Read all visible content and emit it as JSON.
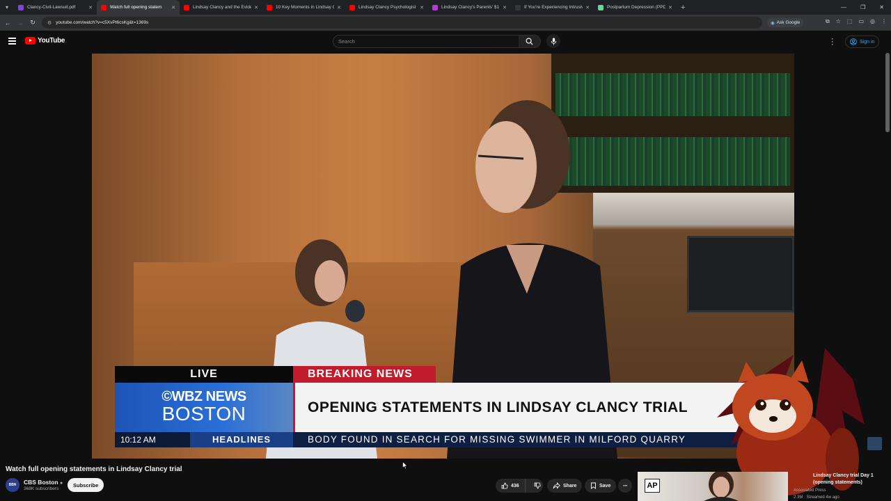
{
  "browser": {
    "tabs": [
      {
        "title": "Clancy-Civil-Lawsuit.pdf",
        "favicon_color": "#7a4ad6"
      },
      {
        "title": "Watch full opening statem",
        "favicon_color": "#ff0000"
      },
      {
        "title": "Lindsay Clancy and the Evidenc",
        "favicon_color": "#ff0000"
      },
      {
        "title": "10 Key Moments in Lindsay Cla",
        "favicon_color": "#ff0000"
      },
      {
        "title": "Lindsay Clancy Psychologist Dr",
        "favicon_color": "#ff0000"
      },
      {
        "title": "Lindsay Clancy's Parents' $1 Mi",
        "favicon_color": "#b03ad6"
      },
      {
        "title": "If You're Experiencing Intrusive",
        "favicon_color": "#35363a"
      },
      {
        "title": "Postpartum Depression (PPD):",
        "favicon_color": "#6ad1a0"
      }
    ],
    "active_tab_index": 1,
    "url": "youtube.com/watch?v=c5XvPt6csKg&t=1369s",
    "ask_google_label": "Ask Google"
  },
  "masthead": {
    "logo_text": "YouTube",
    "search_placeholder": "Search",
    "sign_in_label": "Sign in"
  },
  "video": {
    "lower_third": {
      "live": "LIVE",
      "breaking": "BREAKING NEWS",
      "station_line1": "©WBZ NEWS",
      "station_line2": "BOSTON",
      "headline": "OPENING STATEMENTS IN LINDSAY CLANCY TRIAL",
      "time": "10:12 AM",
      "segment": "HEADLINES",
      "ticker": "BODY FOUND IN SEARCH FOR MISSING SWIMMER IN MILFORD QUARRY"
    }
  },
  "details": {
    "title": "Watch full opening statements in Lindsay Clancy trial",
    "channel_avatar_text": "BBN",
    "channel_name": "CBS Boston",
    "subscribers": "368K subscribers",
    "subscribe_label": "Subscribe",
    "likes": "436",
    "share_label": "Share",
    "save_label": "Save"
  },
  "recommendation": {
    "badge": "AP",
    "title": "Lindsay Clancy trial Day 1 (opening statements)",
    "channel": "Associated Press",
    "meta": "2.3M · Streamed 4w ago"
  }
}
